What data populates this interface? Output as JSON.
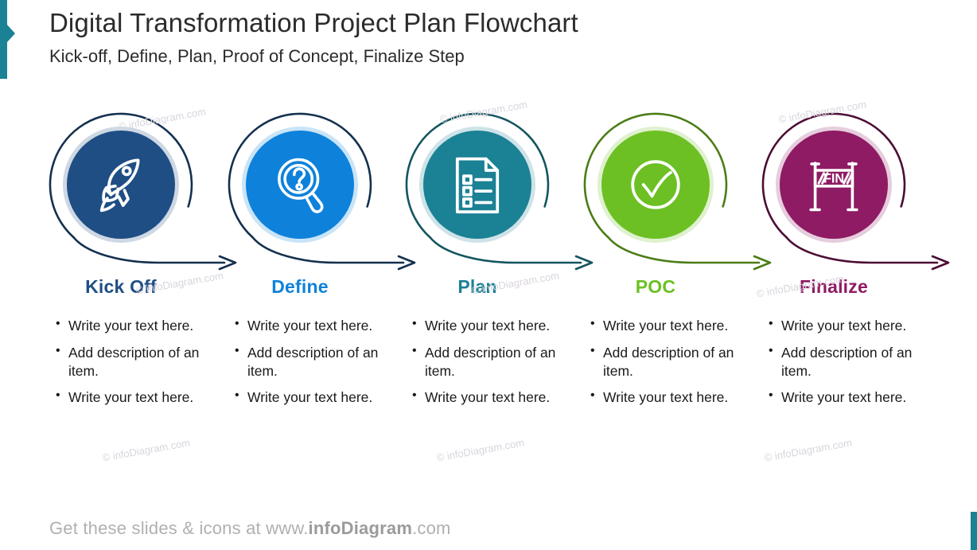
{
  "header": {
    "title": "Digital Transformation Project Plan Flowchart",
    "subtitle": "Kick-off, Define, Plan, Proof of Concept, Finalize Step"
  },
  "footer": {
    "prefix": "Get these slides & icons at www.",
    "brand": "infoDiagram",
    "suffix": ".com"
  },
  "watermark": {
    "text": "© infoDiagram.com"
  },
  "colors": {
    "kickoff": "#1F4E85",
    "define": "#0E82DB",
    "plan": "#1B8195",
    "poc": "#6CC023",
    "finalize": "#8E1B63",
    "accent_teal": "#1B8195",
    "text": "#1a1a1a",
    "footer_grey": "#b0b0b0"
  },
  "steps": [
    {
      "label": "Kick Off",
      "icon": "rocket-icon",
      "color": "#1F4E85",
      "ring_color": "#13304f",
      "bullets": [
        "Write your text here.",
        "Add description of an item.",
        "Write your text here."
      ]
    },
    {
      "label": "Define",
      "icon": "magnifier-question-icon",
      "color": "#0E82DB",
      "ring_color": "#13304f",
      "bullets": [
        "Write your text here.",
        "Add description of an item.",
        "Write your text here."
      ]
    },
    {
      "label": "Plan",
      "icon": "checklist-document-icon",
      "color": "#1B8195",
      "ring_color": "#13555f",
      "bullets": [
        "Write your text here.",
        "Add description of an item.",
        "Write your text here."
      ]
    },
    {
      "label": "POC",
      "icon": "check-circle-icon",
      "color": "#6CC023",
      "ring_color": "#4C7C16",
      "bullets": [
        "Write your text here.",
        "Add description of an item.",
        "Write your text here."
      ]
    },
    {
      "label": "Finalize",
      "icon": "finish-line-icon",
      "color": "#8E1B63",
      "ring_color": "#4c0d34",
      "bullets": [
        "Write your text here.",
        "Add description of an item.",
        "Write your text here."
      ]
    }
  ]
}
